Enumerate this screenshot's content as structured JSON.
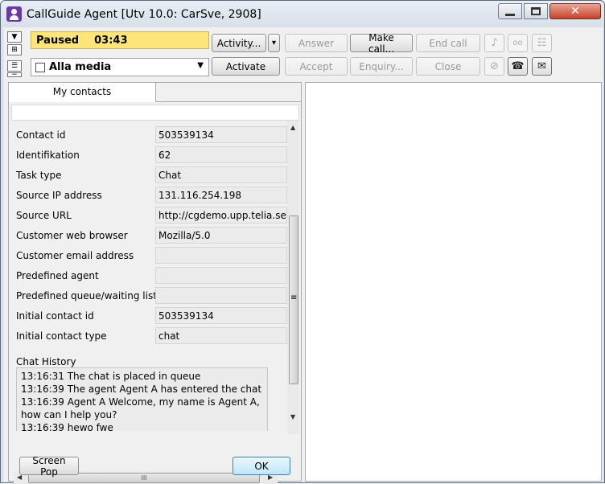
{
  "window": {
    "title": "CallGuide Agent [Utv 10.0: CarSve, 2908]",
    "close_glyph": "✕"
  },
  "status": {
    "state": "Paused",
    "time": "03:43"
  },
  "media": {
    "selected": "Alla media"
  },
  "toolbar": {
    "activity": "Activity...",
    "activity_dropdown": "▾",
    "answer": "Answer",
    "make_call": "Make call...",
    "end_call": "End call",
    "activate": "Activate",
    "accept": "Accept",
    "enquiry": "Enquiry...",
    "close": "Close"
  },
  "tabs": {
    "my_contacts": "My contacts"
  },
  "contact_fields": [
    {
      "label": "Contact id",
      "value": "503539134"
    },
    {
      "label": "Identifikation",
      "value": "62"
    },
    {
      "label": "Task type",
      "value": "Chat"
    },
    {
      "label": "Source IP address",
      "value": "131.116.254.198"
    },
    {
      "label": "Source URL",
      "value": "http://cgdemo.upp.telia.se/"
    },
    {
      "label": "Customer web browser",
      "value": "Mozilla/5.0"
    },
    {
      "label": "Customer email address",
      "value": ""
    },
    {
      "label": "Predefined agent",
      "value": ""
    },
    {
      "label": "Predefined queue/waiting list",
      "value": ""
    },
    {
      "label": "Initial contact id",
      "value": "503539134"
    },
    {
      "label": "Initial contact type",
      "value": "chat"
    }
  ],
  "chat_history": {
    "label": "Chat History",
    "lines": [
      "13:16:31  The chat is placed in queue",
      "13:16:39  The agent Agent A has entered the chat",
      "13:16:39 Agent A Welcome, my name is Agent A,",
      "how can I help you?",
      "13:16:39 hewo fwe"
    ]
  },
  "buttons": {
    "screen_pop": "Screen Pop",
    "ok": "OK"
  },
  "scrollbar": {
    "h_grip": "III",
    "v_grip": "≡"
  },
  "colors": {
    "status_bg": "#fde57a",
    "titlebar": "#dce3ec",
    "close_button": "#c5432a"
  }
}
